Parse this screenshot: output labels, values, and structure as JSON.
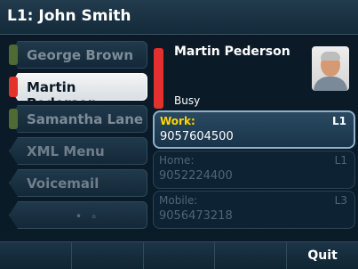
{
  "title": "L1: John Smith",
  "speed_dial": [
    {
      "label": "George Brown",
      "indicator": "green",
      "active": false
    },
    {
      "label": "Martin Pederson",
      "indicator": "red",
      "active": true
    },
    {
      "label": "Samantha Lane",
      "indicator": "green",
      "active": false
    },
    {
      "label": "XML Menu",
      "indicator": "",
      "active": false
    },
    {
      "label": "Voicemail",
      "indicator": "",
      "active": false
    }
  ],
  "more_indicator": "• ∘",
  "contact": {
    "name": "Martin Pederson",
    "status": "Busy",
    "presence_color": "#e4312b"
  },
  "numbers": [
    {
      "label": "Work:",
      "value": "9057604500",
      "line": "L1",
      "selected": true
    },
    {
      "label": "Home:",
      "value": "9052224400",
      "line": "L1",
      "selected": false
    },
    {
      "label": "Mobile:",
      "value": "9056473218",
      "line": "L3",
      "selected": false
    }
  ],
  "softkeys": [
    "",
    "",
    "",
    "",
    "Quit"
  ]
}
